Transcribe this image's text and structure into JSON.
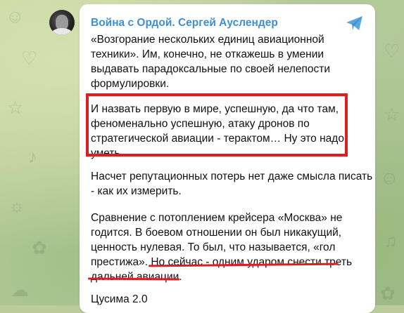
{
  "channel": {
    "name": "Война с Ордой. Сергей Ауслендер"
  },
  "icons": {
    "avatar": "channel-avatar-photo",
    "share": "share-arrow-icon"
  },
  "colors": {
    "channel_name": "#3f8fd2",
    "highlight": "#e11b22",
    "bubble": "#ffffff"
  },
  "message": {
    "paragraph1": [
      "«Возгорание нескольких единиц авиационной",
      "техники». Им, конечно, не откажешь в умении",
      "выдавать парадоксальные по своей нелепости",
      "формулировки."
    ],
    "paragraph2": [
      "И назвать первую в мире, успешную, да что там,",
      "феноменально успешную, атаку дронов по",
      "стратегической авиации - терактом… Ну это надо",
      "уметь."
    ],
    "paragraph3": [
      "Насчет репутационных потерь нет даже смысла писать",
      "- как их измерить."
    ],
    "paragraph4": [
      "Сравнение с потоплением крейсера «Москва» не",
      "годится. В боевом отношении он был никакущий,",
      "ценность нулевая. То был, что называется, «гол",
      "престижа». Но сейчас - одним ударом снести треть",
      "дальней авиации."
    ],
    "signature": "Цусима 2.0"
  }
}
